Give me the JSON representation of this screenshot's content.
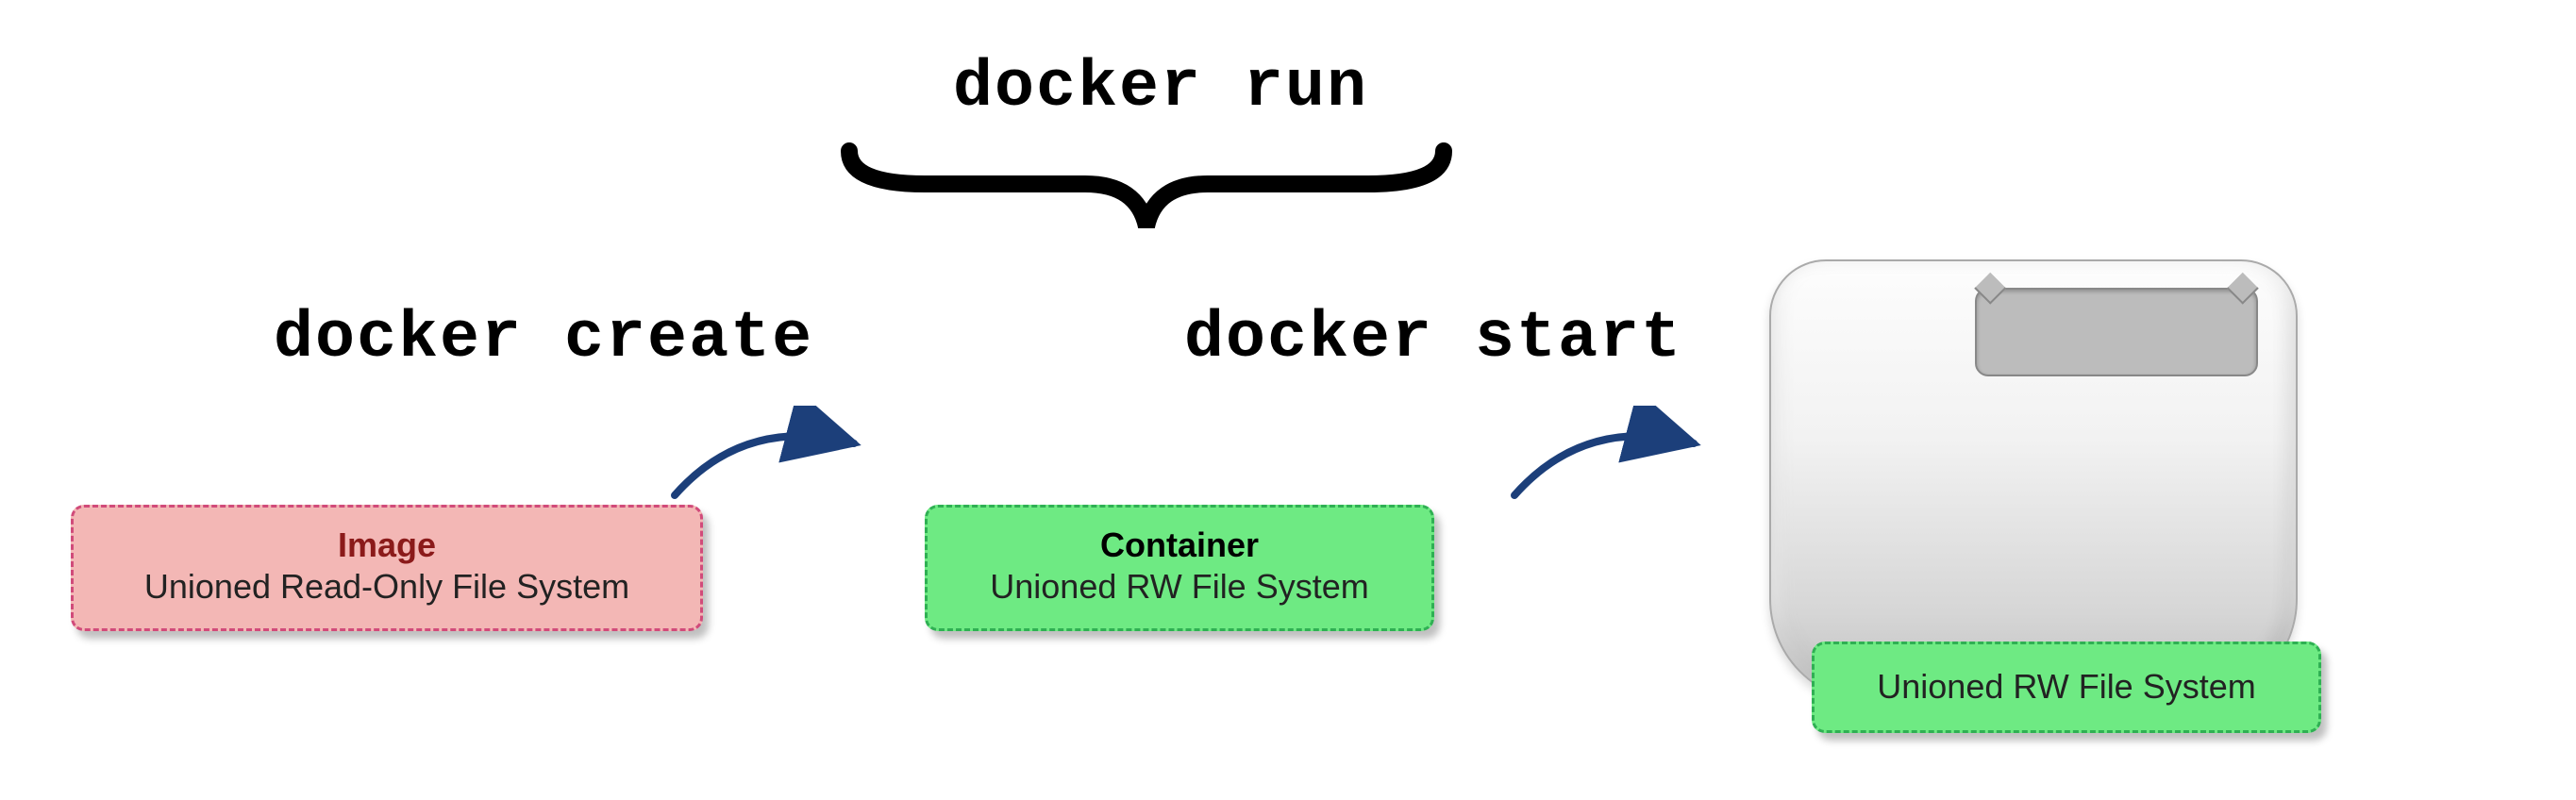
{
  "labels": {
    "docker_run": "docker run",
    "docker_create": "docker create",
    "docker_start": "docker start"
  },
  "image_box": {
    "title": "Image",
    "subtitle": "Unioned Read-Only File System"
  },
  "container_box": {
    "title": "Container",
    "subtitle": "Unioned RW File System"
  },
  "running_box": {
    "subtitle": "Unioned RW File System"
  },
  "colors": {
    "arrow": "#1c3f7a",
    "image_bg": "#f3b7b5",
    "image_border": "#d14b7a",
    "container_bg": "#6eea83",
    "container_border": "#2fb053"
  }
}
